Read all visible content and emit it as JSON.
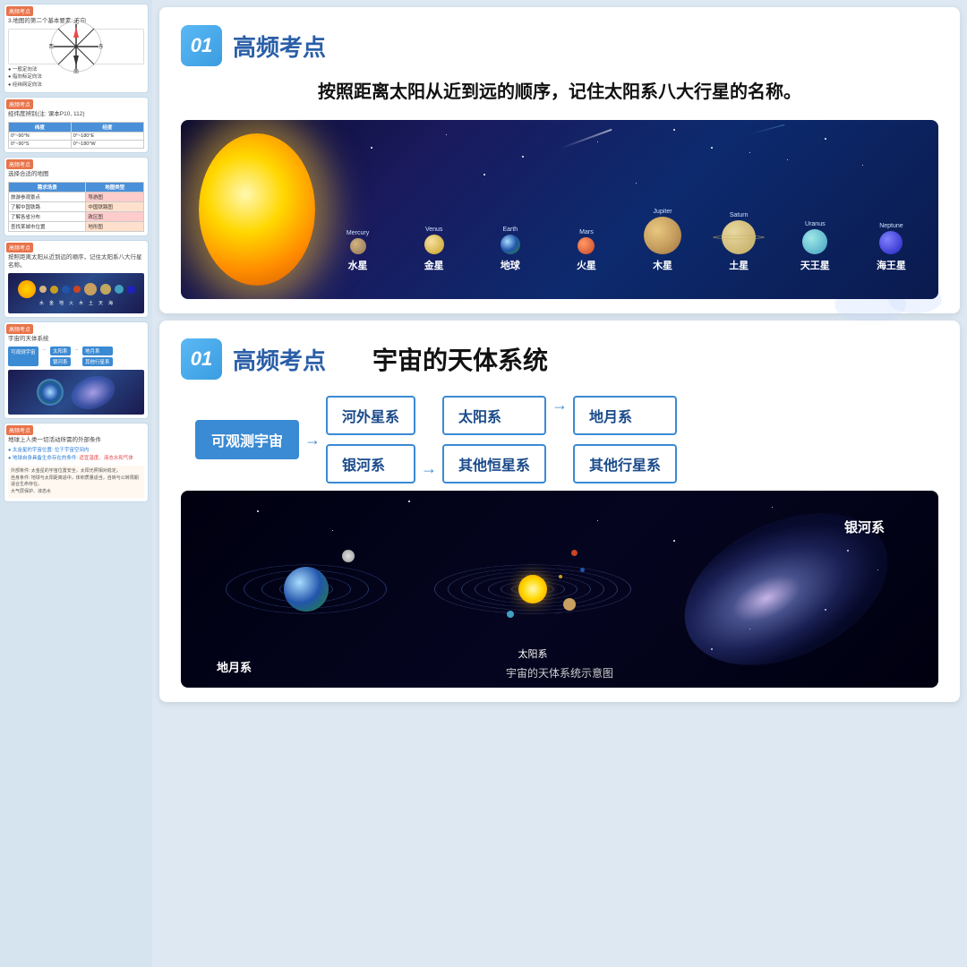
{
  "sidebar": {
    "cards": [
      {
        "tag": "高频考点",
        "tag_color": "orange",
        "body": "3.地图的第二个基本要素: 方向",
        "type": "compass"
      },
      {
        "tag": "高频考点",
        "tag_color": "orange",
        "body": "经纬度辨别(注: 课本P10, 112)",
        "type": "table"
      },
      {
        "tag": "高频考点",
        "tag_color": "orange",
        "body": "选择合适的地图",
        "type": "table2"
      },
      {
        "tag": "高频考点",
        "tag_color": "orange",
        "body": "按照距离太阳从近到远的顺序, 记住太阳系八大行星的名称。",
        "type": "solar"
      },
      {
        "tag": "高频考点",
        "tag_color": "orange",
        "body": "宇宙的天体系统",
        "type": "cosmic"
      },
      {
        "tag": "高频考点",
        "tag_color": "orange",
        "body": "地球上人类一切活动所需的外部条件",
        "type": "earth_cond"
      }
    ]
  },
  "slide1": {
    "section_num": "01",
    "section_title": "高频考点",
    "intro_text": "按照距离太阳从近到远的顺序，记住太阳系八大行星的名称。",
    "planets": [
      {
        "en": "Mercury",
        "zh": "水星",
        "class": "p-mercury"
      },
      {
        "en": "Venus",
        "zh": "金星",
        "class": "p-venus"
      },
      {
        "en": "Earth",
        "zh": "地球",
        "class": "p-earth"
      },
      {
        "en": "Mars",
        "zh": "火星",
        "class": "p-mars"
      },
      {
        "en": "Jupiter",
        "zh": "木星",
        "class": "p-jupiter"
      },
      {
        "en": "Saturn",
        "zh": "土星",
        "class": "p-saturn"
      },
      {
        "en": "Uranus",
        "zh": "天王星",
        "class": "p-uranus"
      },
      {
        "en": "Neptune",
        "zh": "海王星",
        "class": "p-neptune"
      }
    ]
  },
  "slide2": {
    "section_num": "01",
    "section_title": "高频考点",
    "cosmic_title": "宇宙的天体系统",
    "flow": {
      "root": "可观测宇宙",
      "branches": [
        {
          "label": "河外星系"
        },
        {
          "label": "银河系",
          "sub_branches": [
            {
              "label": "太阳系",
              "sub": [
                "地月系",
                "其他行星系"
              ]
            },
            {
              "label": "其他恒星系"
            }
          ]
        }
      ]
    },
    "galaxy_labels": {
      "diyuxi": "地月系",
      "taiyangxi": "太阳系",
      "yinhexi": "银河系",
      "caption": "宇宙的天体系统示意图"
    }
  }
}
